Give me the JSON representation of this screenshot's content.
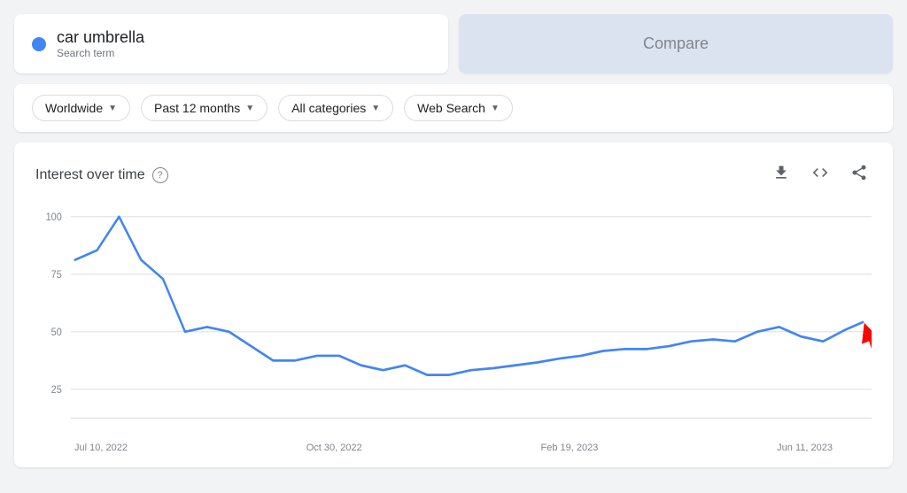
{
  "search_term": {
    "name": "car umbrella",
    "label": "Search term"
  },
  "compare": {
    "label": "Compare"
  },
  "filters": {
    "location": {
      "label": "Worldwide"
    },
    "time_range": {
      "label": "Past 12 months"
    },
    "category": {
      "label": "All categories"
    },
    "search_type": {
      "label": "Web Search"
    }
  },
  "chart": {
    "title": "Interest over time",
    "x_labels": [
      "Jul 10, 2022",
      "Oct 30, 2022",
      "Feb 19, 2023",
      "Jun 11, 2023"
    ],
    "y_labels": [
      "100",
      "75",
      "50",
      "25"
    ],
    "actions": {
      "download": "⬇",
      "embed": "<>",
      "share": "share"
    }
  }
}
